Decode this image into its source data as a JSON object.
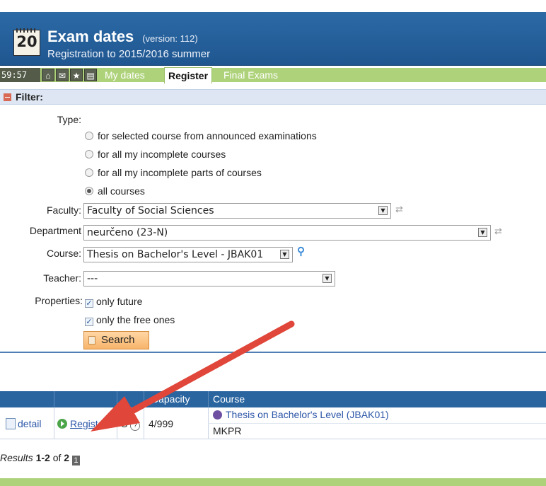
{
  "header": {
    "calendar_number": "20",
    "title": "Exam dates",
    "version": "(version: 112)",
    "subtitle": "Registration to 2015/2016 summer"
  },
  "tabbar": {
    "timer": "59:57",
    "tabs": [
      {
        "label": "My dates",
        "active": false
      },
      {
        "label": "Register",
        "active": true
      },
      {
        "label": "Final Exams",
        "active": false
      }
    ]
  },
  "filter": {
    "title": "Filter:",
    "type_label": "Type:",
    "type_options": [
      {
        "label": "for selected course from announced examinations",
        "selected": false
      },
      {
        "label": "for all my incomplete courses",
        "selected": false
      },
      {
        "label": "for all my incomplete parts of courses",
        "selected": false
      },
      {
        "label": "all courses",
        "selected": true
      }
    ],
    "faculty_label": "Faculty:",
    "faculty_value": "Faculty of Social Sciences",
    "department_label": "Department",
    "department_value": "neurčeno (23-N)",
    "course_label": "Course:",
    "course_value": "Thesis on Bachelor's Level - JBAK01",
    "teacher_label": "Teacher:",
    "teacher_value": "---",
    "properties_label": "Properties:",
    "properties": [
      {
        "label": "only future",
        "checked": true
      },
      {
        "label": "only the free ones",
        "checked": true
      }
    ],
    "search_label": "Search"
  },
  "results_table": {
    "columns": [
      "Capacity",
      "Course"
    ],
    "row": {
      "detail": "detail",
      "register": "Register",
      "type": "S",
      "capacity": "4/999",
      "course": "Thesis on Bachelor's Level (JBAK01)",
      "group": "MKPR"
    }
  },
  "results_summary": {
    "prefix": "Results",
    "range": "1-2",
    "of": "of",
    "total": "2",
    "page": "1"
  },
  "colors": {
    "header_blue": "#1f5690",
    "tab_green": "#aed27a",
    "table_header": "#2a65a0",
    "arrow_red": "#e0463a"
  }
}
